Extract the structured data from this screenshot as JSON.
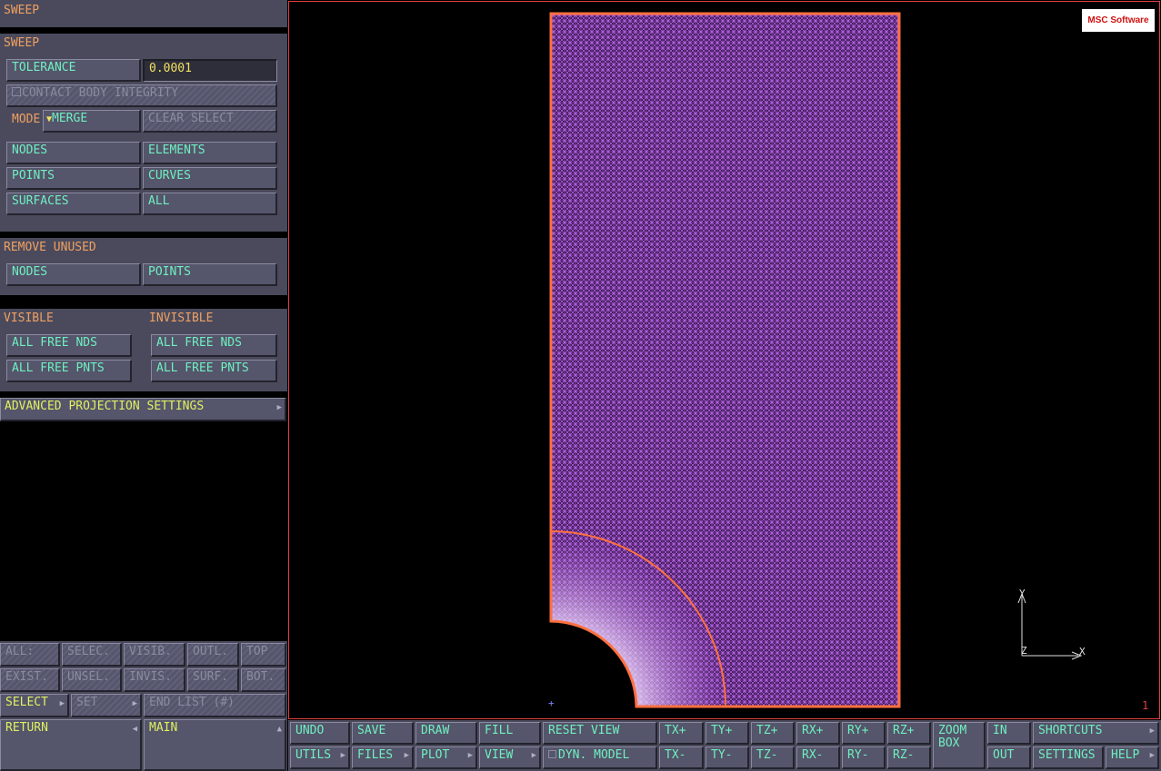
{
  "panel": {
    "title": "SWEEP",
    "sweep_header": "SWEEP",
    "tolerance_label": "TOLERANCE",
    "tolerance_value": "0.0001",
    "contact_body_integrity": "CONTACT BODY INTEGRITY",
    "mode_label": "MODE",
    "mode_value": "MERGE",
    "clear_select": "CLEAR SELECT",
    "sweep_buttons": [
      "NODES",
      "ELEMENTS",
      "POINTS",
      "CURVES",
      "SURFACES",
      "ALL"
    ],
    "remove_unused_header": "REMOVE UNUSED",
    "remove_unused_buttons": [
      "NODES",
      "POINTS"
    ],
    "visible_header": "VISIBLE",
    "invisible_header": "INVISIBLE",
    "visible_buttons": [
      "ALL FREE NDS",
      "ALL FREE PNTS"
    ],
    "invisible_buttons": [
      "ALL FREE NDS",
      "ALL FREE PNTS"
    ],
    "advanced": "ADVANCED PROJECTION SETTINGS"
  },
  "selection": {
    "row1": [
      "ALL:",
      "SELEC.",
      "VISIB.",
      "OUTL.",
      "TOP"
    ],
    "row2": [
      "EXIST.",
      "UNSEL.",
      "INVIS.",
      "SURF.",
      "BOT."
    ],
    "select": "SELECT",
    "set": "SET",
    "end_list": "END LIST (#)",
    "return": "RETURN",
    "main": "MAIN"
  },
  "viewport": {
    "logo_text": "MSC Software",
    "axis_y": "Y",
    "axis_x": "X",
    "axis_z": "Z",
    "window_number": "1",
    "origin_marker": "+",
    "mesh_color": "#b060e0",
    "boundary_color": "#ff7040"
  },
  "toolbar": {
    "undo": "UNDO",
    "save": "SAVE",
    "draw": "DRAW",
    "fill": "FILL",
    "reset_view": "RESET VIEW",
    "tx_plus": "TX+",
    "ty_plus": "TY+",
    "tz_plus": "TZ+",
    "rx_plus": "RX+",
    "ry_plus": "RY+",
    "rz_plus": "RZ+",
    "zoom_box": "ZOOM BOX",
    "in": "IN",
    "shortcuts": "SHORTCUTS",
    "utils": "UTILS",
    "files": "FILES",
    "plot": "PLOT",
    "view": "VIEW",
    "dyn_model": "DYN. MODEL",
    "tx_minus": "TX-",
    "ty_minus": "TY-",
    "tz_minus": "TZ-",
    "rx_minus": "RX-",
    "ry_minus": "RY-",
    "rz_minus": "RZ-",
    "out": "OUT",
    "settings": "SETTINGS",
    "help": "HELP"
  }
}
